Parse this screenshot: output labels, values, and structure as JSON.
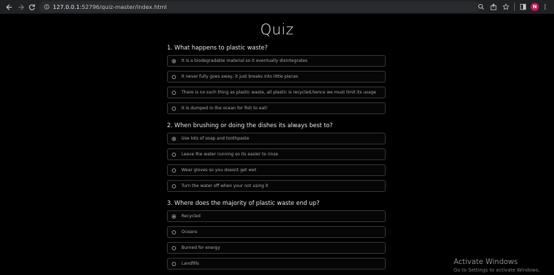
{
  "browser": {
    "url_host": "127.0.0.1",
    "url_path": ":52796/quiz-master/index.html",
    "profile_initial": "N"
  },
  "page": {
    "title": "Quiz"
  },
  "questions": [
    {
      "text": "1. What happens to plastic waste?",
      "options": [
        {
          "label": "It is a biodegradable material so it eventually disintegrates",
          "checked": true
        },
        {
          "label": "It never fully goes away, it just breaks into little pieces",
          "checked": false
        },
        {
          "label": "There is no such thing as plastic waste, all plastic is recycled,hence we must limit its usage",
          "checked": false
        },
        {
          "label": "It is dumped in the ocean for fish to eat!",
          "checked": false
        }
      ]
    },
    {
      "text": "2. When brushing or doing the dishes its always best to?",
      "options": [
        {
          "label": "Use lots of soap and toothpaste",
          "checked": true
        },
        {
          "label": "Leave the water running so its easier to rinse",
          "checked": false
        },
        {
          "label": "Wear gloves so you doesnt get wet",
          "checked": false
        },
        {
          "label": "Turn the water off when your not using it",
          "checked": false
        }
      ]
    },
    {
      "text": "3. Where does the majority of plastic waste end up?",
      "options": [
        {
          "label": "Recycled",
          "checked": true
        },
        {
          "label": "Oceans",
          "checked": false
        },
        {
          "label": "Burned for energy",
          "checked": false
        },
        {
          "label": "Landfills",
          "checked": false
        }
      ]
    }
  ],
  "watermark": {
    "title": "Activate Windows",
    "subtitle": "Go to Settings to activate Windows."
  }
}
